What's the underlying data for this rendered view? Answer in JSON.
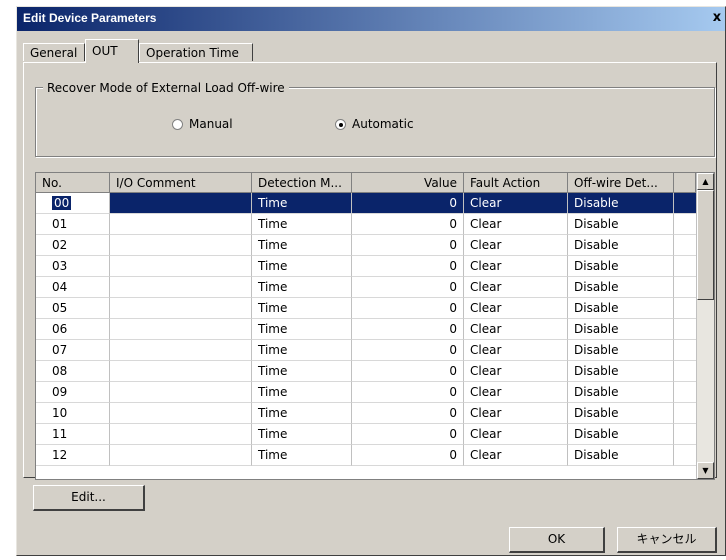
{
  "window": {
    "title": "Edit Device Parameters",
    "close_glyph": "x"
  },
  "tabs": [
    {
      "label": "General"
    },
    {
      "label": "OUT"
    },
    {
      "label": "Operation Time"
    }
  ],
  "recover_mode": {
    "legend": "Recover Mode of External Load Off-wire",
    "options": [
      {
        "label": "Manual",
        "selected": false
      },
      {
        "label": "Automatic",
        "selected": true
      }
    ]
  },
  "grid": {
    "columns": [
      "No.",
      "I/O Comment",
      "Detection M...",
      "Value",
      "Fault Action",
      "Off-wire Det..."
    ],
    "rows": [
      [
        "00",
        "",
        "Time",
        "0",
        "Clear",
        "Disable"
      ],
      [
        "01",
        "",
        "Time",
        "0",
        "Clear",
        "Disable"
      ],
      [
        "02",
        "",
        "Time",
        "0",
        "Clear",
        "Disable"
      ],
      [
        "03",
        "",
        "Time",
        "0",
        "Clear",
        "Disable"
      ],
      [
        "04",
        "",
        "Time",
        "0",
        "Clear",
        "Disable"
      ],
      [
        "05",
        "",
        "Time",
        "0",
        "Clear",
        "Disable"
      ],
      [
        "06",
        "",
        "Time",
        "0",
        "Clear",
        "Disable"
      ],
      [
        "07",
        "",
        "Time",
        "0",
        "Clear",
        "Disable"
      ],
      [
        "08",
        "",
        "Time",
        "0",
        "Clear",
        "Disable"
      ],
      [
        "09",
        "",
        "Time",
        "0",
        "Clear",
        "Disable"
      ],
      [
        "10",
        "",
        "Time",
        "0",
        "Clear",
        "Disable"
      ],
      [
        "11",
        "",
        "Time",
        "0",
        "Clear",
        "Disable"
      ],
      [
        "12",
        "",
        "Time",
        "0",
        "Clear",
        "Disable"
      ]
    ],
    "selected_row": 0,
    "scroll_up_glyph": "▲",
    "scroll_down_glyph": "▼"
  },
  "buttons": {
    "edit": "Edit...",
    "ok": "OK",
    "cancel": "キャンセル"
  }
}
